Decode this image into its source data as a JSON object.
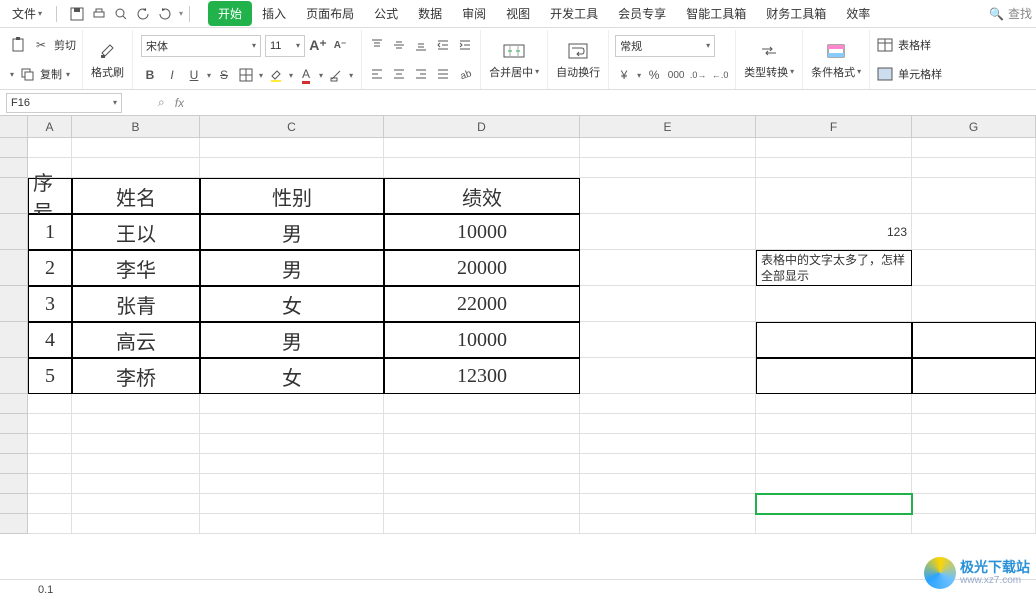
{
  "menu": {
    "file_label": "文件",
    "tabs": [
      "开始",
      "插入",
      "页面布局",
      "公式",
      "数据",
      "审阅",
      "视图",
      "开发工具",
      "会员专享",
      "智能工具箱",
      "财务工具箱",
      "效率"
    ],
    "active_index": 0,
    "search_placeholder": "查找"
  },
  "ribbon": {
    "cut": "剪切",
    "copy": "复制",
    "format_painter": "格式刷",
    "font_name": "宋体",
    "font_size": "11",
    "merge_center": "合并居中",
    "wrap_text": "自动换行",
    "number_format": "常规",
    "type_convert": "类型转换",
    "conditional_format": "条件格式",
    "cell_styles": "单元格样",
    "table_style": "表格样"
  },
  "namebox": {
    "value": "F16"
  },
  "formula": {
    "fx": "fx",
    "value": ""
  },
  "columns": [
    "A",
    "B",
    "C",
    "D",
    "E",
    "F",
    "G"
  ],
  "table": {
    "headers": [
      "序号",
      "姓名",
      "性别",
      "绩效"
    ],
    "rows": [
      [
        "1",
        "王以",
        "男",
        "10000"
      ],
      [
        "2",
        "李华",
        "男",
        "20000"
      ],
      [
        "3",
        "张青",
        "女",
        "22000"
      ],
      [
        "4",
        "高云",
        "男",
        "10000"
      ],
      [
        "5",
        "李桥",
        "女",
        "12300"
      ]
    ]
  },
  "cellF5": "123",
  "cellF6": "表格中的文字太多了，怎样全部显示",
  "status_value": "0.1",
  "watermark": {
    "name": "极光下载站",
    "url": "www.xz7.com"
  }
}
